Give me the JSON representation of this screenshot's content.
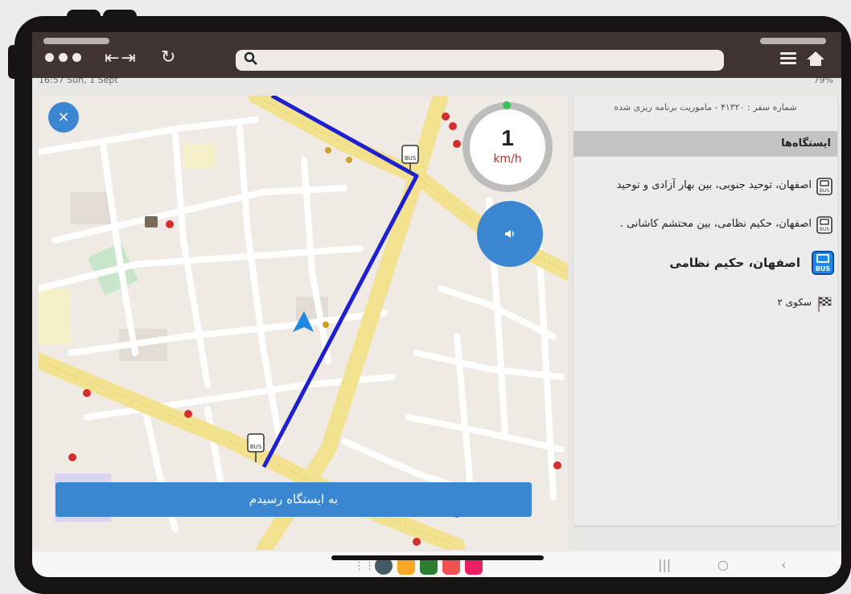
{
  "statusbar": {
    "left": "16:57  Sun, 1 Sept",
    "right": "79%"
  },
  "map": {
    "close_label": "×",
    "speed_value": "1",
    "speed_unit": "km/h",
    "arrive_button_label": "به ایستگاه رسیدم"
  },
  "panel": {
    "trip_title": "شماره سفر : ۴۱۳۲۰ - ماموریت برنامه ریزی شده",
    "stops_header": "ایستگاه‌ها",
    "stops": [
      {
        "label": "اصفهان، توحید جنوبی، بین بهار آزادی و توحید",
        "icon": "bus-stop-icon"
      },
      {
        "label": "اصفهان، حکیم نظامی، بین محتشم کاشانی .",
        "icon": "bus-stop-icon"
      },
      {
        "label": "اصفهان، حکیم نظامی",
        "icon": "bus-stop-icon",
        "current": true
      },
      {
        "label": "سکوی ۲",
        "icon": "checkered-flag-icon"
      }
    ]
  },
  "colors": {
    "accent": "#3b86d1",
    "route": "#1d1fd1",
    "road": "#f4e69a",
    "frame": "#171312",
    "toolbar": "#3f3431"
  }
}
